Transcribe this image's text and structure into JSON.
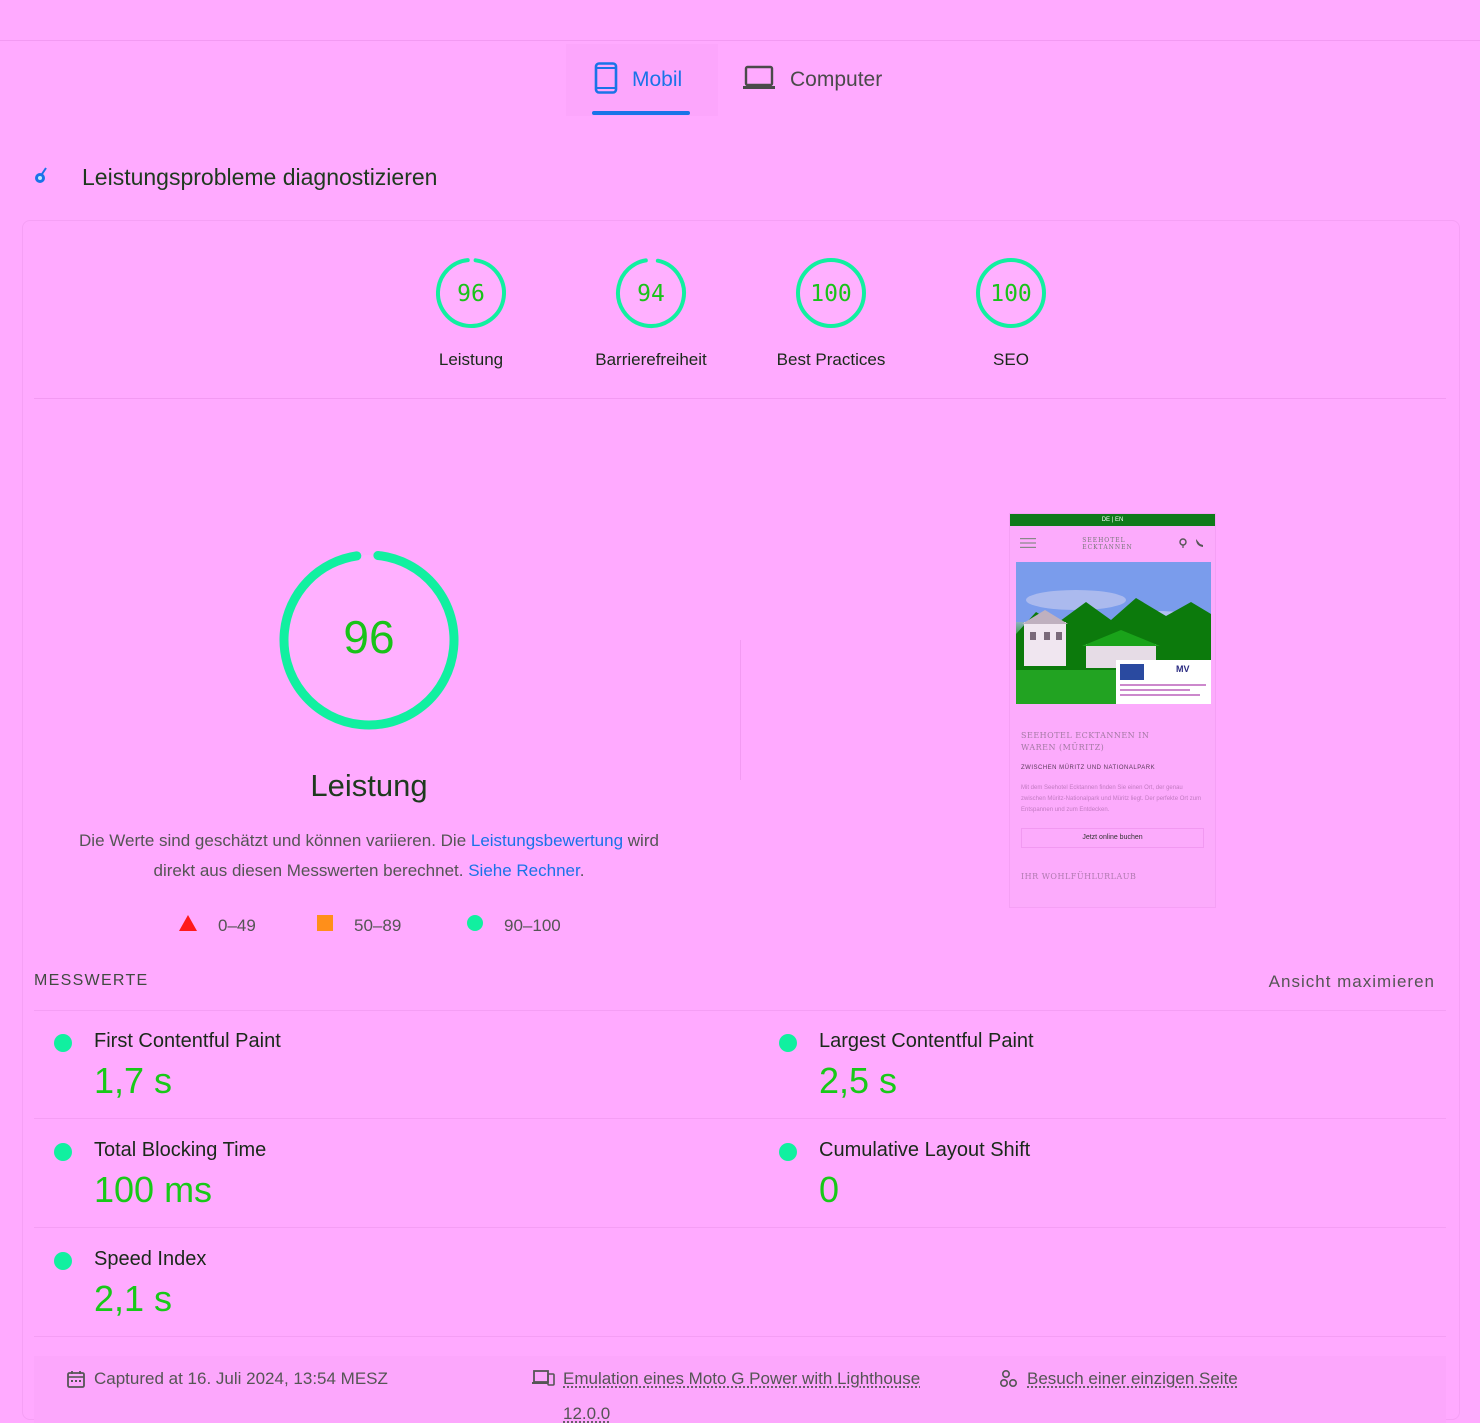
{
  "tabs": {
    "mobile_label": "Mobil",
    "desktop_label": "Computer",
    "active": "Mobil"
  },
  "section": {
    "title": "Leistungsprobleme diagnostizieren"
  },
  "scores": [
    {
      "value": "96",
      "label": "Leistung"
    },
    {
      "value": "94",
      "label": "Barrierefreiheit"
    },
    {
      "value": "100",
      "label": "Best Practices"
    },
    {
      "value": "100",
      "label": "SEO"
    }
  ],
  "performance": {
    "score": "96",
    "title": "Leistung",
    "desc_part1": "Die Werte sind geschätzt und können variieren. Die ",
    "desc_link1": "Leistungsbewertung",
    "desc_part2": " wird direkt aus diesen Messwerten berechnet. ",
    "desc_link2": "Siehe Rechner",
    "desc_part3": "."
  },
  "legend": {
    "poor": "0–49",
    "average": "50–89",
    "good": "90–100"
  },
  "thumbnail": {
    "top_bar": "DE | EN",
    "logo_line1": "SEEHOTEL",
    "logo_line2": "ECKTANNEN",
    "heading_line1": "SEEHOTEL ECKTANNEN IN",
    "heading_line2": "WAREN (MÜRITZ)",
    "subheading": "ZWISCHEN MÜRITZ UND NATIONALPARK",
    "paragraph": "Mit dem Seehotel Ecktannen finden Sie einen Ort, der genau zwischen Müritz-Nationalpark und Müritz liegt. Der perfekte Ort zum Entspannen und zum Entdecken.",
    "button": "Jetzt online buchen",
    "footer_heading": "IHR WOHLFÜHLURLAUB"
  },
  "metrics": {
    "heading": "MESSWERTE",
    "toggle": "Ansicht maximieren",
    "items": [
      {
        "name": "First Contentful Paint",
        "value": "1,7 s"
      },
      {
        "name": "Largest Contentful Paint",
        "value": "2,5 s"
      },
      {
        "name": "Total Blocking Time",
        "value": "100 ms"
      },
      {
        "name": "Cumulative Layout Shift",
        "value": "0"
      },
      {
        "name": "Speed Index",
        "value": "2,1 s"
      }
    ]
  },
  "footer": {
    "captured": "Captured at 16. Juli 2024, 13:54 MESZ",
    "emulation_line1": "Emulation eines Moto G Power with Lighthouse",
    "emulation_line2": "12.0.0",
    "session": "Besuch einer einzigen Seite"
  },
  "colors": {
    "accent": "#1a73e8",
    "good": "#11f0a0",
    "good_text": "#19c319",
    "average": "#ff8f1a",
    "poor": "#ff1a1a",
    "background": "#ffaaff"
  }
}
